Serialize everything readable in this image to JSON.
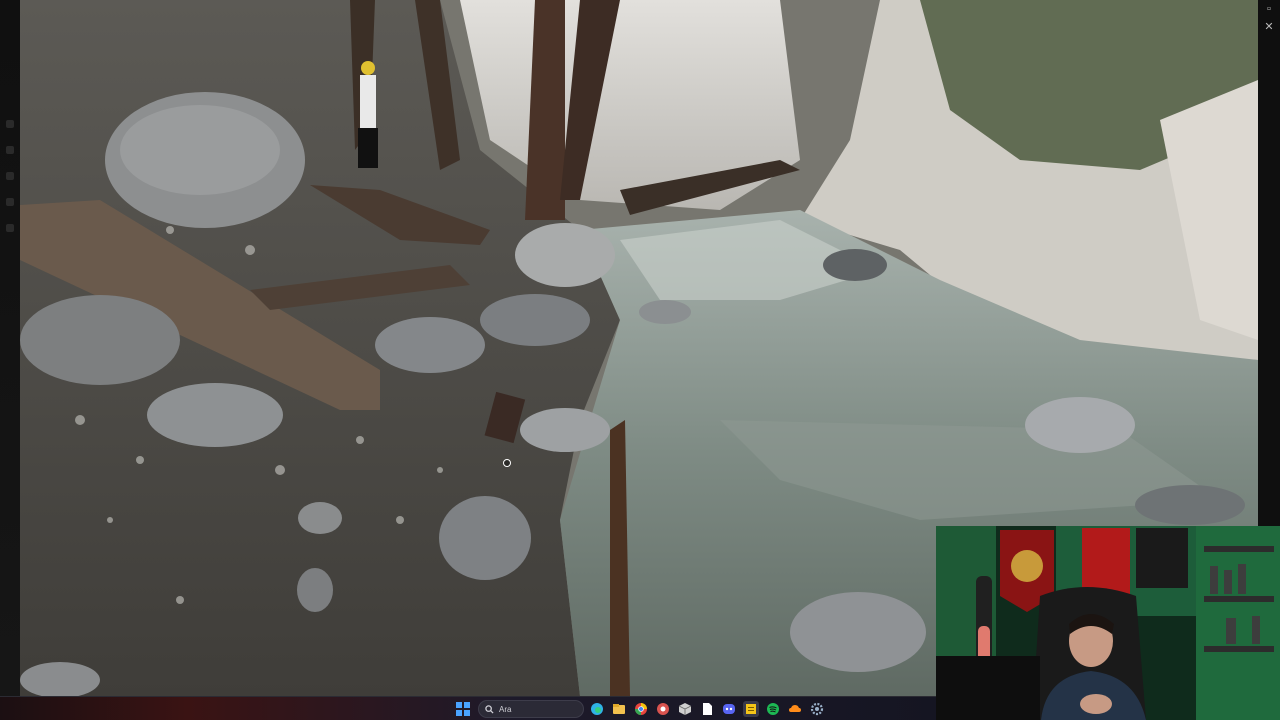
{
  "window": {
    "close_glyph": "✕",
    "minimize_glyph": "▫"
  },
  "taskbar": {
    "search": {
      "placeholder": "Ara",
      "icon": "search-icon"
    },
    "apps": [
      {
        "name": "start-icon",
        "color": "#4aa3ff"
      },
      {
        "name": "edge-icon",
        "color": "#2fb3e6"
      },
      {
        "name": "file-explorer-icon",
        "color": "#f2c14e"
      },
      {
        "name": "chrome-icon",
        "color": "#e8453c"
      },
      {
        "name": "chrome-alt-icon",
        "color": "#d9534f"
      },
      {
        "name": "app-cube-icon",
        "color": "#cfcfcf"
      },
      {
        "name": "document-icon",
        "color": "#ffffff"
      },
      {
        "name": "discord-icon",
        "color": "#5865f2"
      },
      {
        "name": "notes-icon",
        "color": "#f5c518"
      },
      {
        "name": "spotify-icon",
        "color": "#1db954"
      },
      {
        "name": "cloud-icon",
        "color": "#ff8c1a"
      },
      {
        "name": "settings-icon",
        "color": "#9ab0c9"
      }
    ]
  }
}
